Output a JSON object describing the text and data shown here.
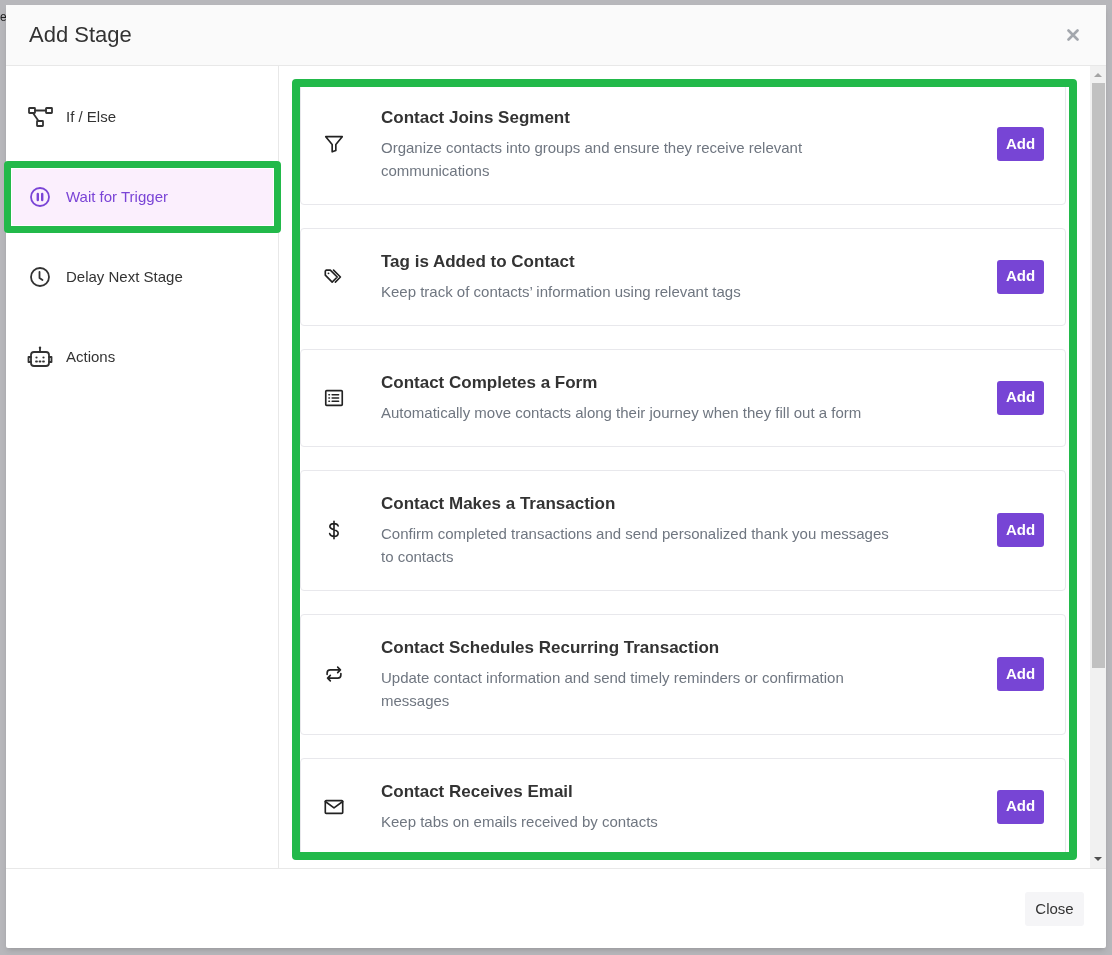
{
  "backdrop": {
    "text": "e"
  },
  "dialog": {
    "title": "Add Stage"
  },
  "sidebar": {
    "items": [
      {
        "label": "If / Else",
        "selected": false,
        "highlighted": false
      },
      {
        "label": "Wait for Trigger",
        "selected": true,
        "highlighted": true
      },
      {
        "label": "Delay Next Stage",
        "selected": false,
        "highlighted": false
      },
      {
        "label": "Actions",
        "selected": false,
        "highlighted": false
      }
    ]
  },
  "triggers": {
    "highlighted": true,
    "items": [
      {
        "title": "Contact Joins Segment",
        "description": "Organize contacts into groups and ensure they receive relevant communications",
        "button": "Add"
      },
      {
        "title": "Tag is Added to Contact",
        "description": "Keep track of contacts’ information using relevant tags",
        "button": "Add"
      },
      {
        "title": "Contact Completes a Form",
        "description": "Automatically move contacts along their journey when they fill out a form",
        "button": "Add"
      },
      {
        "title": "Contact Makes a Transaction",
        "description": "Confirm completed transactions and send personalized thank you messages to contacts",
        "button": "Add"
      },
      {
        "title": "Contact Schedules Recurring Transaction",
        "description": "Update contact information and send timely reminders or confirmation messages",
        "button": "Add"
      },
      {
        "title": "Contact Receives Email",
        "description": "Keep tabs on emails received by contacts",
        "button": "Add"
      }
    ]
  },
  "footer": {
    "button": "Close"
  }
}
